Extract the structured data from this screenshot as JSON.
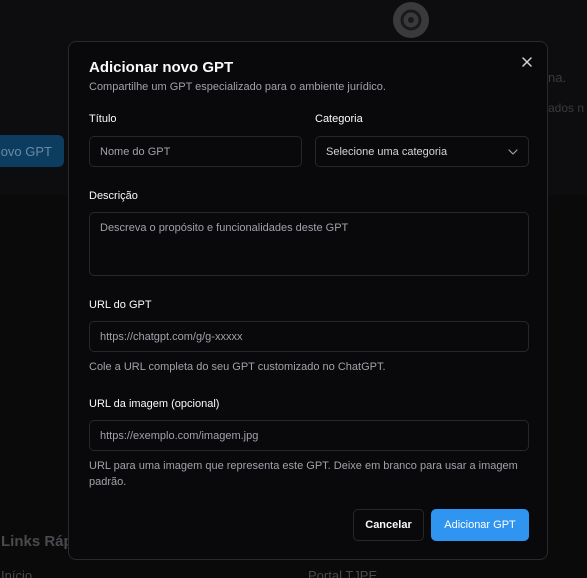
{
  "background": {
    "right_text_1": "na.",
    "right_text_2": "ados n",
    "button_label": "novo GPT",
    "links_title": "Links Rápi",
    "link_1": "Início",
    "link_2": "Portal TJPE"
  },
  "modal": {
    "title": "Adicionar novo GPT",
    "subtitle": "Compartilhe um GPT especializado para o ambiente jurídico.",
    "close_icon": "close-icon",
    "fields": {
      "title_label": "Título",
      "title_placeholder": "Nome do GPT",
      "category_label": "Categoria",
      "category_placeholder": "Selecione uma categoria",
      "description_label": "Descrição",
      "description_placeholder": "Descreva o propósito e funcionalidades deste GPT",
      "url_label": "URL do GPT",
      "url_placeholder": "https://chatgpt.com/g/g-xxxxx",
      "url_help": "Cole a URL completa do seu GPT customizado no ChatGPT.",
      "image_label": "URL da imagem (opcional)",
      "image_placeholder": "https://exemplo.com/imagem.jpg",
      "image_help": "URL para uma imagem que representa este GPT. Deixe em branco para usar a imagem padrão."
    },
    "buttons": {
      "cancel": "Cancelar",
      "submit": "Adicionar GPT"
    }
  },
  "colors": {
    "accent": "#2f95f0",
    "modal_bg": "#09090b",
    "border": "#27272a",
    "muted_text": "#a1a1aa"
  }
}
